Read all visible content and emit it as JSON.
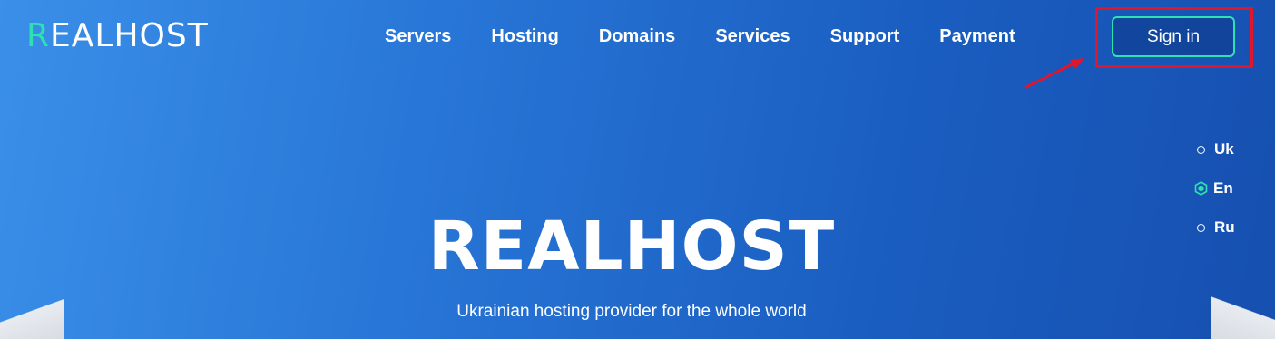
{
  "logo": {
    "accent_letter": "R",
    "rest": "EALHOST"
  },
  "nav": {
    "items": [
      {
        "label": "Servers"
      },
      {
        "label": "Hosting"
      },
      {
        "label": "Domains"
      },
      {
        "label": "Services"
      },
      {
        "label": "Support"
      },
      {
        "label": "Payment"
      }
    ]
  },
  "header": {
    "signin_label": "Sign in"
  },
  "languages": {
    "items": [
      {
        "label": "Uk",
        "active": false
      },
      {
        "label": "En",
        "active": true
      },
      {
        "label": "Ru",
        "active": false
      }
    ]
  },
  "hero": {
    "title": "REALHOST",
    "subtitle": "Ukrainian hosting provider for the whole world"
  },
  "colors": {
    "accent": "#2de2b0",
    "highlight_box": "#e0162c",
    "background_start": "#3a8fe8",
    "background_end": "#1650b0"
  }
}
